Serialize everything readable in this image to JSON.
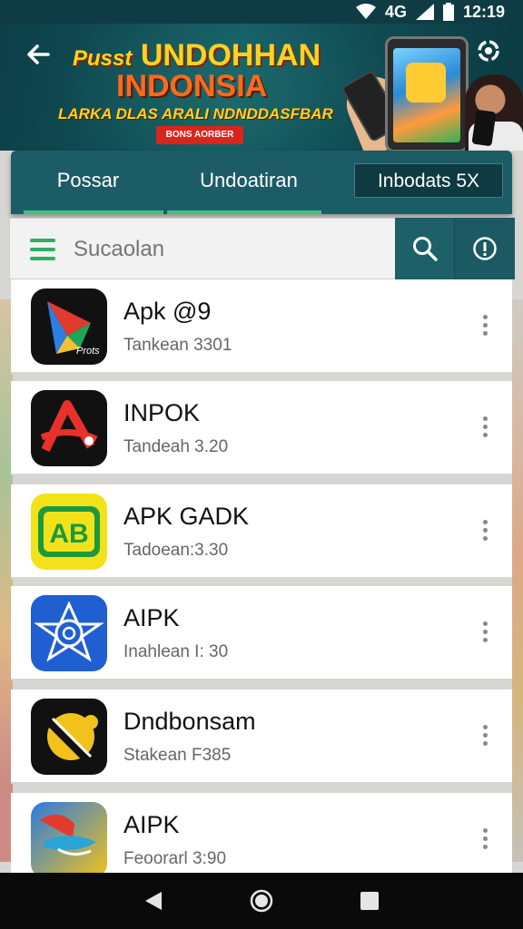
{
  "status_bar": {
    "network": "4G",
    "time": "12:19"
  },
  "banner": {
    "title_prefix": "Pusst",
    "title_line1": "UNDOHHAN",
    "title_line2": "INDONSIA",
    "subtitle": "LARKA DLAS ARALI NDNDDASFBAR",
    "badge": "BONS AORBER"
  },
  "tabs": [
    {
      "label": "Possar"
    },
    {
      "label": "Undoatiran"
    },
    {
      "label": "Inbodats 5X"
    }
  ],
  "search": {
    "placeholder": "Sucaolan"
  },
  "apps": [
    {
      "name": "Apk @9",
      "meta": "Tankean 3301",
      "icon": "play-triangle-icon",
      "icon_label": "Prots"
    },
    {
      "name": "INPOK",
      "meta": "Tandeah 3.20",
      "icon": "red-a-icon"
    },
    {
      "name": "APK GADK",
      "meta": "Tadoean:3.30",
      "icon": "ab-green-icon",
      "icon_label": "AB"
    },
    {
      "name": "AIPK",
      "meta": "Inahlean I: 30",
      "icon": "blue-swirl-icon"
    },
    {
      "name": "Dndbonsam",
      "meta": "Stakean F385",
      "icon": "yellow-ball-icon"
    },
    {
      "name": "AIPK",
      "meta": "Feoorarl 3:90",
      "icon": "bird-icon"
    }
  ],
  "colors": {
    "teal_dark": "#0f3c44",
    "teal": "#1d6068",
    "accent_green": "#3ec27d",
    "banner_yellow": "#ffd21f",
    "banner_orange": "#ff6a1a"
  }
}
